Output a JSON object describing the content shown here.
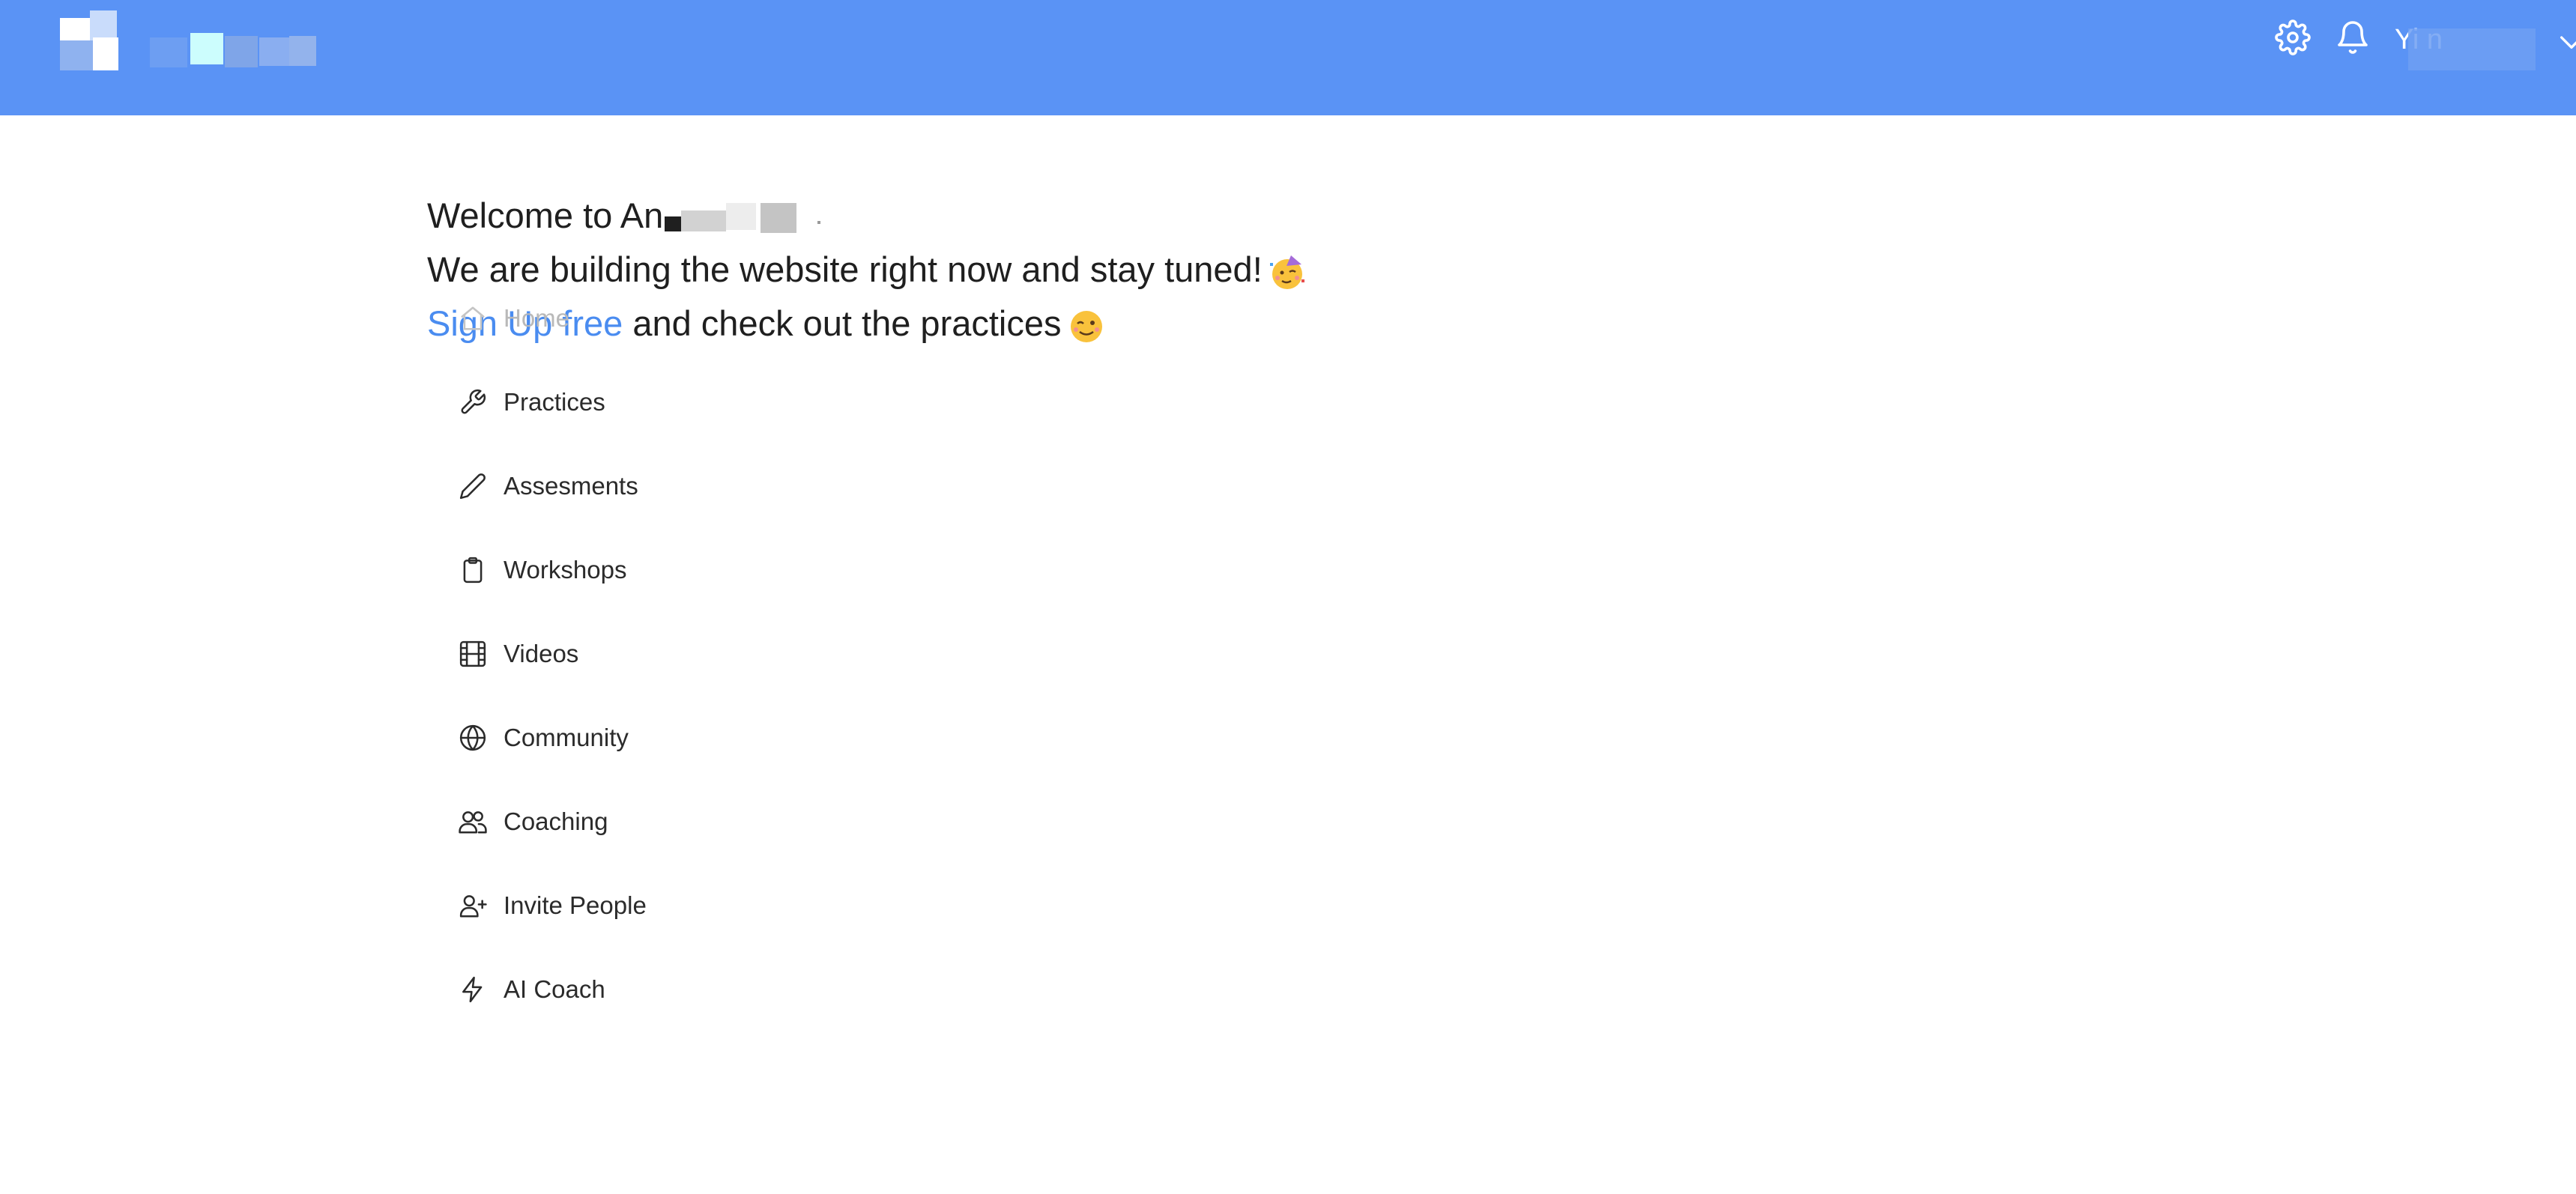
{
  "colors": {
    "header_bg": "#5a93f5",
    "link": "#4a8cf0",
    "text": "#1f1f1f"
  },
  "header": {
    "logo_icon": "app-logo-icon",
    "settings_icon": "gear-icon",
    "notifications_icon": "bell-icon",
    "user_name": "Yi    n",
    "user_menu_icon": "chevron-down-icon"
  },
  "welcome": {
    "line1_prefix": "Welcome to An",
    "line1_suffix": "",
    "line2_text": "We are building the website right now and stay tuned!",
    "line2_emoji_icon": "partying-face-emoji-icon",
    "line3_link": "Sign Up free",
    "line3_text": "and check out the practices",
    "line3_emoji_icon": "winking-face-emoji-icon"
  },
  "nav": {
    "items": [
      {
        "label": "Home",
        "icon": "home-icon"
      },
      {
        "label": "Practices",
        "icon": "wrench-icon"
      },
      {
        "label": "Assesments",
        "icon": "pencil-icon"
      },
      {
        "label": "Workshops",
        "icon": "clipboard-icon"
      },
      {
        "label": "Videos",
        "icon": "film-icon"
      },
      {
        "label": "Community",
        "icon": "globe-icon"
      },
      {
        "label": "Coaching",
        "icon": "users-icon"
      },
      {
        "label": "Invite People",
        "icon": "user-plus-icon"
      },
      {
        "label": "AI Coach",
        "icon": "lightning-icon"
      }
    ]
  }
}
